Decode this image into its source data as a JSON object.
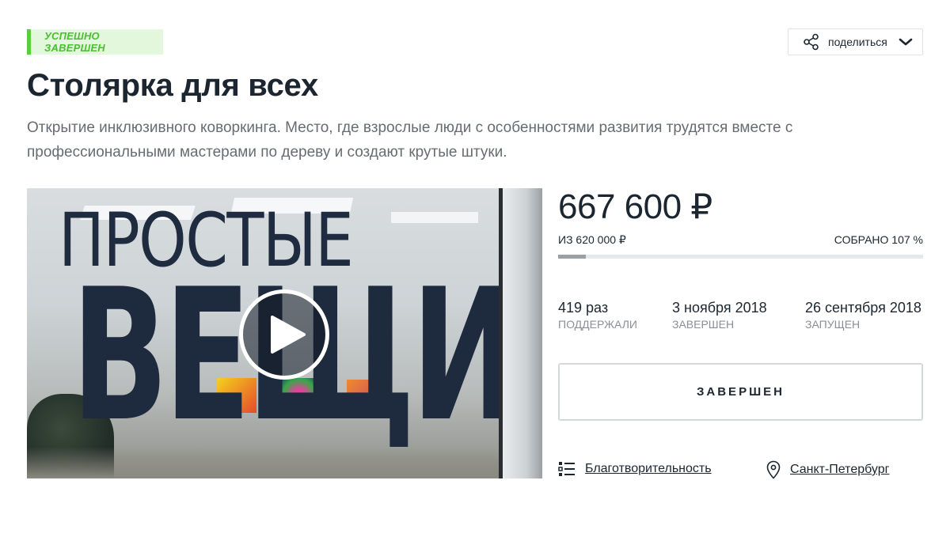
{
  "status_badge": "УСПЕШНО ЗАВЕРШЕН",
  "share": {
    "label": "поделиться"
  },
  "project": {
    "title": "Столярка для всех",
    "description": "Открытие инклюзивного коворкинга. Место, где взрослые люди с особенностями развития трудятся вместе с профессиональными мастерами по дереву и создают крутые штуки."
  },
  "video": {
    "overlay_line1": "ПРОСТЫЕ",
    "overlay_line2": "ВЕЩИ"
  },
  "funding": {
    "amount": "667 600 ₽",
    "goal": "ИЗ 620 000 ₽",
    "collected": "СОБРАНО 107 %",
    "progress_fraction": 0.075
  },
  "stats": [
    {
      "value": "419 раз",
      "label": "ПОДДЕРЖАЛИ"
    },
    {
      "value": "3 ноября 2018",
      "label": "ЗАВЕРШЕН"
    },
    {
      "value": "26 сентября 2018",
      "label": "ЗАПУЩЕН"
    }
  ],
  "finished_button": "ЗАВЕРШЕН",
  "category": {
    "label": "Благотворительность",
    "icon": "list-icon"
  },
  "location": {
    "label": "Санкт-Петербург",
    "icon": "location-pin-icon"
  },
  "colors": {
    "accent_green": "#5ccc3f",
    "text_dark": "#1c2630"
  }
}
